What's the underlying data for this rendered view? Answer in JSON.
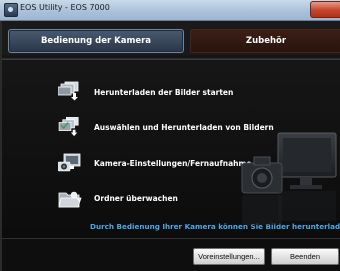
{
  "window": {
    "title": "EOS Utility - EOS 7000"
  },
  "tabs": [
    {
      "label": "Bedienung der Kamera",
      "active": true
    },
    {
      "label": "Zubehör",
      "active": false
    }
  ],
  "menu": {
    "items": [
      {
        "label": "Herunterladen der Bilder starten",
        "icon": "download-images-icon"
      },
      {
        "label": "Auswählen und Herunterladen von Bildern",
        "icon": "select-download-icon"
      },
      {
        "label": "Kamera-Einstellungen/Fernaufnahme",
        "icon": "camera-remote-icon"
      },
      {
        "label": "Ordner überwachen",
        "icon": "folder-watch-icon"
      }
    ]
  },
  "hint": "Durch Bedienung Ihrer Kamera können Sie Bilder herunterladen.",
  "buttons": {
    "settings": "Voreinstellungen...",
    "quit": "Beenden"
  },
  "colors": {
    "hint_text": "#4aa8e8",
    "active_tab": "#3a4a60",
    "inactive_tab": "#2e160e"
  }
}
